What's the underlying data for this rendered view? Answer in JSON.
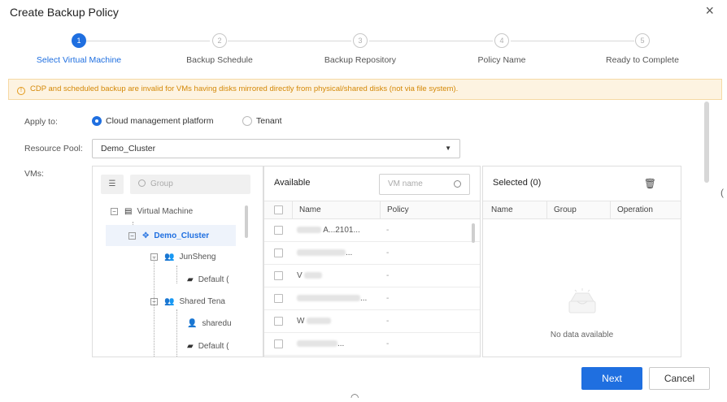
{
  "dialog": {
    "title": "Create Backup Policy",
    "close_glyph": "×"
  },
  "steps": [
    {
      "number": "1",
      "label": "Select Virtual Machine",
      "active": true
    },
    {
      "number": "2",
      "label": "Backup Schedule",
      "active": false
    },
    {
      "number": "3",
      "label": "Backup Repository",
      "active": false
    },
    {
      "number": "4",
      "label": "Policy Name",
      "active": false
    },
    {
      "number": "5",
      "label": "Ready to Complete",
      "active": false
    }
  ],
  "warning": {
    "icon": "info-icon",
    "text": "CDP and scheduled backup are invalid for VMs having disks mirrored directly from physical/shared disks (not via file system)."
  },
  "apply_to": {
    "label": "Apply to:",
    "options": [
      {
        "label": "Cloud management platform",
        "checked": true
      },
      {
        "label": "Tenant",
        "checked": false
      }
    ]
  },
  "resource_pool": {
    "label": "Resource Pool:",
    "value": "Demo_Cluster"
  },
  "vms": {
    "label": "VMs:",
    "tree": {
      "search_placeholder": "Group",
      "nodes": [
        {
          "label": "Virtual Machine",
          "icon": "server-icon"
        },
        {
          "label": "Demo_Cluster",
          "icon": "cluster-icon",
          "selected": true
        },
        {
          "label": "JunSheng",
          "icon": "users-icon"
        },
        {
          "label": "Default (",
          "icon": "folder-icon"
        },
        {
          "label": "Shared Tena",
          "icon": "users-icon"
        },
        {
          "label": "sharedu",
          "icon": "user-icon"
        },
        {
          "label": "Default (",
          "icon": "folder-icon"
        }
      ]
    },
    "available": {
      "title": "Available",
      "search_placeholder": "VM name",
      "columns": [
        "Name",
        "Policy"
      ],
      "rows": [
        {
          "name": "A...2101...",
          "policy": "-"
        },
        {
          "name": "...",
          "policy": "-"
        },
        {
          "name": "V",
          "policy": "-"
        },
        {
          "name": "...",
          "policy": "-"
        },
        {
          "name": "W",
          "policy": "-"
        },
        {
          "name": "...",
          "policy": "-"
        }
      ]
    },
    "selected": {
      "title": "Selected (0)",
      "columns": [
        "Name",
        "Group",
        "Operation"
      ],
      "empty_text": "No data available"
    }
  },
  "buttons": {
    "next": "Next",
    "cancel": "Cancel"
  },
  "colors": {
    "primary": "#1f6fe0",
    "warning_bg": "#fdf3e1",
    "warning_text": "#d48806"
  }
}
